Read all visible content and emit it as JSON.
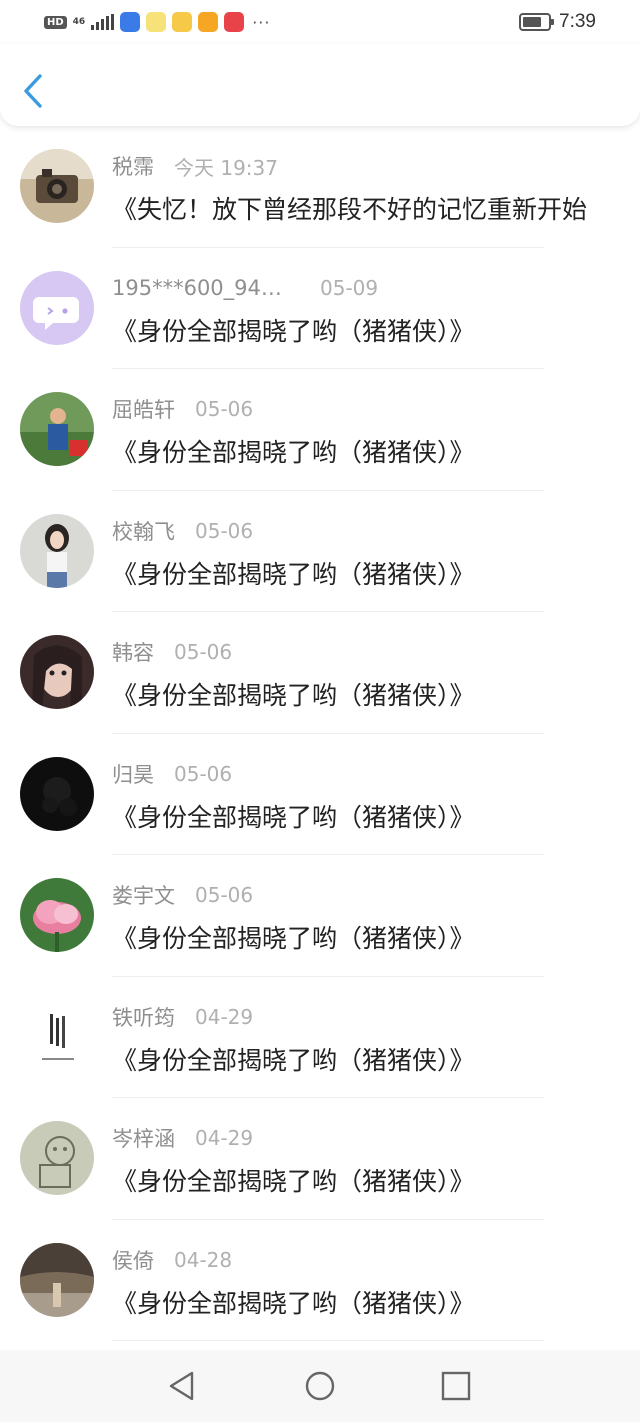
{
  "status_bar": {
    "hd": "HD",
    "network": "46",
    "time": "7:39",
    "battery_level": 0.75,
    "app_icon_colors": [
      "#3b7be8",
      "#f7c948",
      "#f5a623",
      "#f06a2a",
      "#e9434a"
    ],
    "more": "···"
  },
  "nav": {
    "back_icon": "chevron-left-icon",
    "accent_color": "#3a9be0"
  },
  "comments": [
    {
      "name": "税霈",
      "time": "今天 19:37",
      "title": "《失忆！放下曾经那段不好的记忆重新开始"
    },
    {
      "name": "195***600_944...",
      "time": "05-09",
      "title": "《身份全部揭晓了哟（猪猪侠）》"
    },
    {
      "name": "屈皓轩",
      "time": "05-06",
      "title": "《身份全部揭晓了哟（猪猪侠）》"
    },
    {
      "name": "校翰飞",
      "time": "05-06",
      "title": "《身份全部揭晓了哟（猪猪侠）》"
    },
    {
      "name": "韩容",
      "time": "05-06",
      "title": "《身份全部揭晓了哟（猪猪侠）》"
    },
    {
      "name": "归昊",
      "time": "05-06",
      "title": "《身份全部揭晓了哟（猪猪侠）》"
    },
    {
      "name": "娄宇文",
      "time": "05-06",
      "title": "《身份全部揭晓了哟（猪猪侠）》"
    },
    {
      "name": "铁听筠",
      "time": "04-29",
      "title": "《身份全部揭晓了哟（猪猪侠）》"
    },
    {
      "name": "岑梓涵",
      "time": "04-29",
      "title": "《身份全部揭晓了哟（猪猪侠）》"
    },
    {
      "name": "侯倚",
      "time": "04-28",
      "title": "《身份全部揭晓了哟（猪猪侠）》"
    }
  ],
  "system_nav": {
    "back": "triangle-back-icon",
    "home": "circle-home-icon",
    "recents": "square-recents-icon"
  }
}
